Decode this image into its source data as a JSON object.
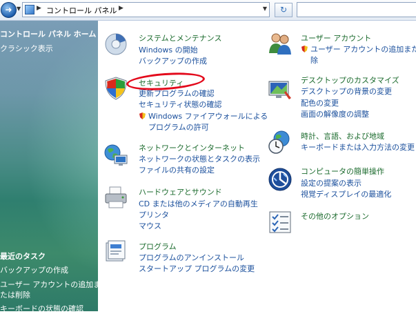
{
  "address_bar": {
    "breadcrumb": "コントロール パネル",
    "search_placeholder": ""
  },
  "sidebar": {
    "home_label": "コントロール パネル ホーム",
    "classic_label": "クラシック表示",
    "recent_tasks_title": "最近のタスク",
    "recent_tasks": [
      "バックアップの作成",
      "ユーザー アカウントの追加ま",
      "たは削除",
      "キーボードの状態の確認"
    ]
  },
  "categories": {
    "system": {
      "title": "システムとメンテナンス",
      "links": [
        "Windows の開始",
        "バックアップの作成"
      ]
    },
    "security": {
      "title": "セキュリティ",
      "links": [
        "更新プログラムの確認",
        "セキュリティ状態の確認",
        "Windows ファイアウォールによる",
        "プログラムの許可"
      ]
    },
    "network": {
      "title": "ネットワークとインターネット",
      "links": [
        "ネットワークの状態とタスクの表示",
        "ファイルの共有の設定"
      ]
    },
    "hardware": {
      "title": "ハードウェアとサウンド",
      "links": [
        "CD または他のメディアの自動再生",
        "プリンタ",
        "マウス"
      ]
    },
    "programs": {
      "title": "プログラム",
      "links": [
        "プログラムのアンインストール",
        "スタートアップ プログラムの変更"
      ]
    },
    "user_accounts": {
      "title": "ユーザー アカウント",
      "links": [
        "ユーザー アカウントの追加または",
        "除"
      ]
    },
    "appearance": {
      "title": "デスクトップのカスタマイズ",
      "links": [
        "デスクトップの背景の変更",
        "配色の変更",
        "画面の解像度の調整"
      ]
    },
    "clock": {
      "title": "時計、言語、および地域",
      "links": [
        "キーボードまたは入力方法の変更"
      ]
    },
    "ease_of_access": {
      "title": "コンピュータの簡単操作",
      "links": [
        "設定の提案の表示",
        "視覚ディスプレイの最適化"
      ]
    },
    "other": {
      "title": "その他のオプション"
    }
  },
  "colors": {
    "category_title": "#1a6a2c",
    "link": "#1a4f9c",
    "highlight": "#e3091b"
  }
}
